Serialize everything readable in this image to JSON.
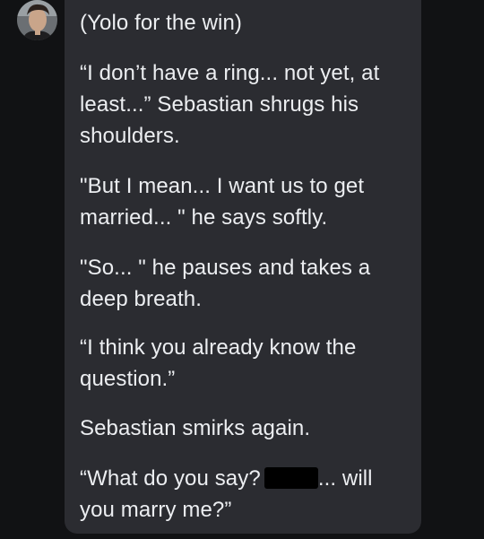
{
  "avatar": {
    "icon": "character-avatar",
    "alt": ""
  },
  "message": {
    "paragraphs": [
      "(Yolo for the win)",
      "“I don’t have a ring... not yet, at least...” Sebastian shrugs his shoulders.",
      "\"But I mean... I want us to get married... \" he says softly.",
      "\"So... \" he pauses and takes a deep breath.",
      "“I think you already know the question.”",
      "Sebastian smirks again."
    ],
    "last_before": "“What do you say?",
    "last_after": "... will you marry me?”"
  },
  "colors": {
    "background": "#111214",
    "bubble": "#2b2c31",
    "text": "#eceef1"
  }
}
